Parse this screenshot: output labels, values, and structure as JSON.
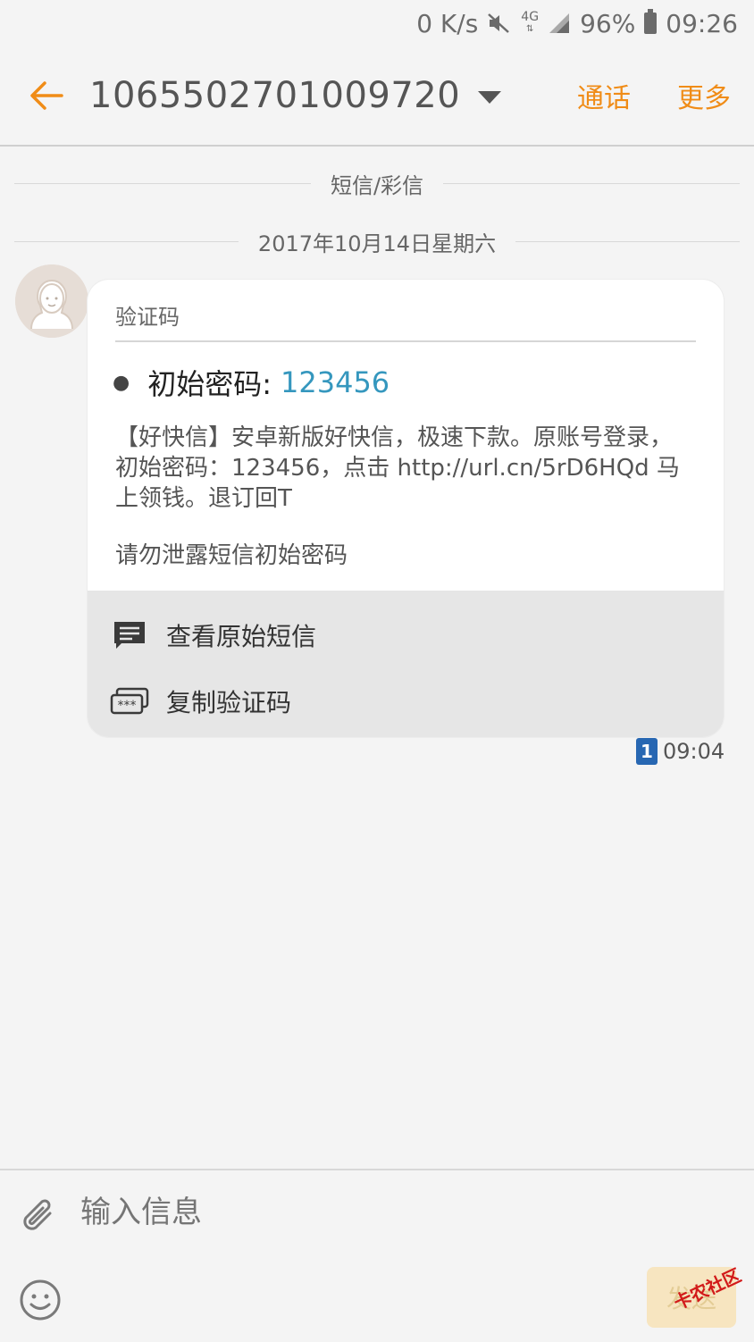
{
  "status_bar": {
    "net_speed": "0 K/s",
    "network": "4G",
    "battery": "96%",
    "time": "09:26"
  },
  "header": {
    "title": "1065502701009720",
    "call": "通话",
    "more": "更多"
  },
  "dividers": {
    "type": "短信/彩信",
    "date": "2017年10月14日星期六"
  },
  "message": {
    "card_title": "验证码",
    "code_label": "初始密码:",
    "code_value": "123456",
    "body": "【好快信】安卓新版好快信，极速下款。原账号登录，初始密码：123456，点击 http://url.cn/5rD6HQd 马上领钱。退订回T",
    "warning": "请勿泄露短信初始密码",
    "action_view": "查看原始短信",
    "action_copy": "复制验证码",
    "sim": "1",
    "time": "09:04"
  },
  "composer": {
    "placeholder": "输入信息",
    "send": "发送"
  },
  "watermark": "卡农社区",
  "colors": {
    "accent": "#f08c17",
    "code_link": "#3597be",
    "sim_badge": "#2767b2"
  },
  "icons": [
    "back-arrow-icon",
    "dropdown-arrow-icon",
    "mute-icon",
    "signal-icon",
    "battery-icon",
    "avatar-icon",
    "message-icon",
    "copy-code-icon",
    "attach-icon",
    "emoji-icon"
  ]
}
